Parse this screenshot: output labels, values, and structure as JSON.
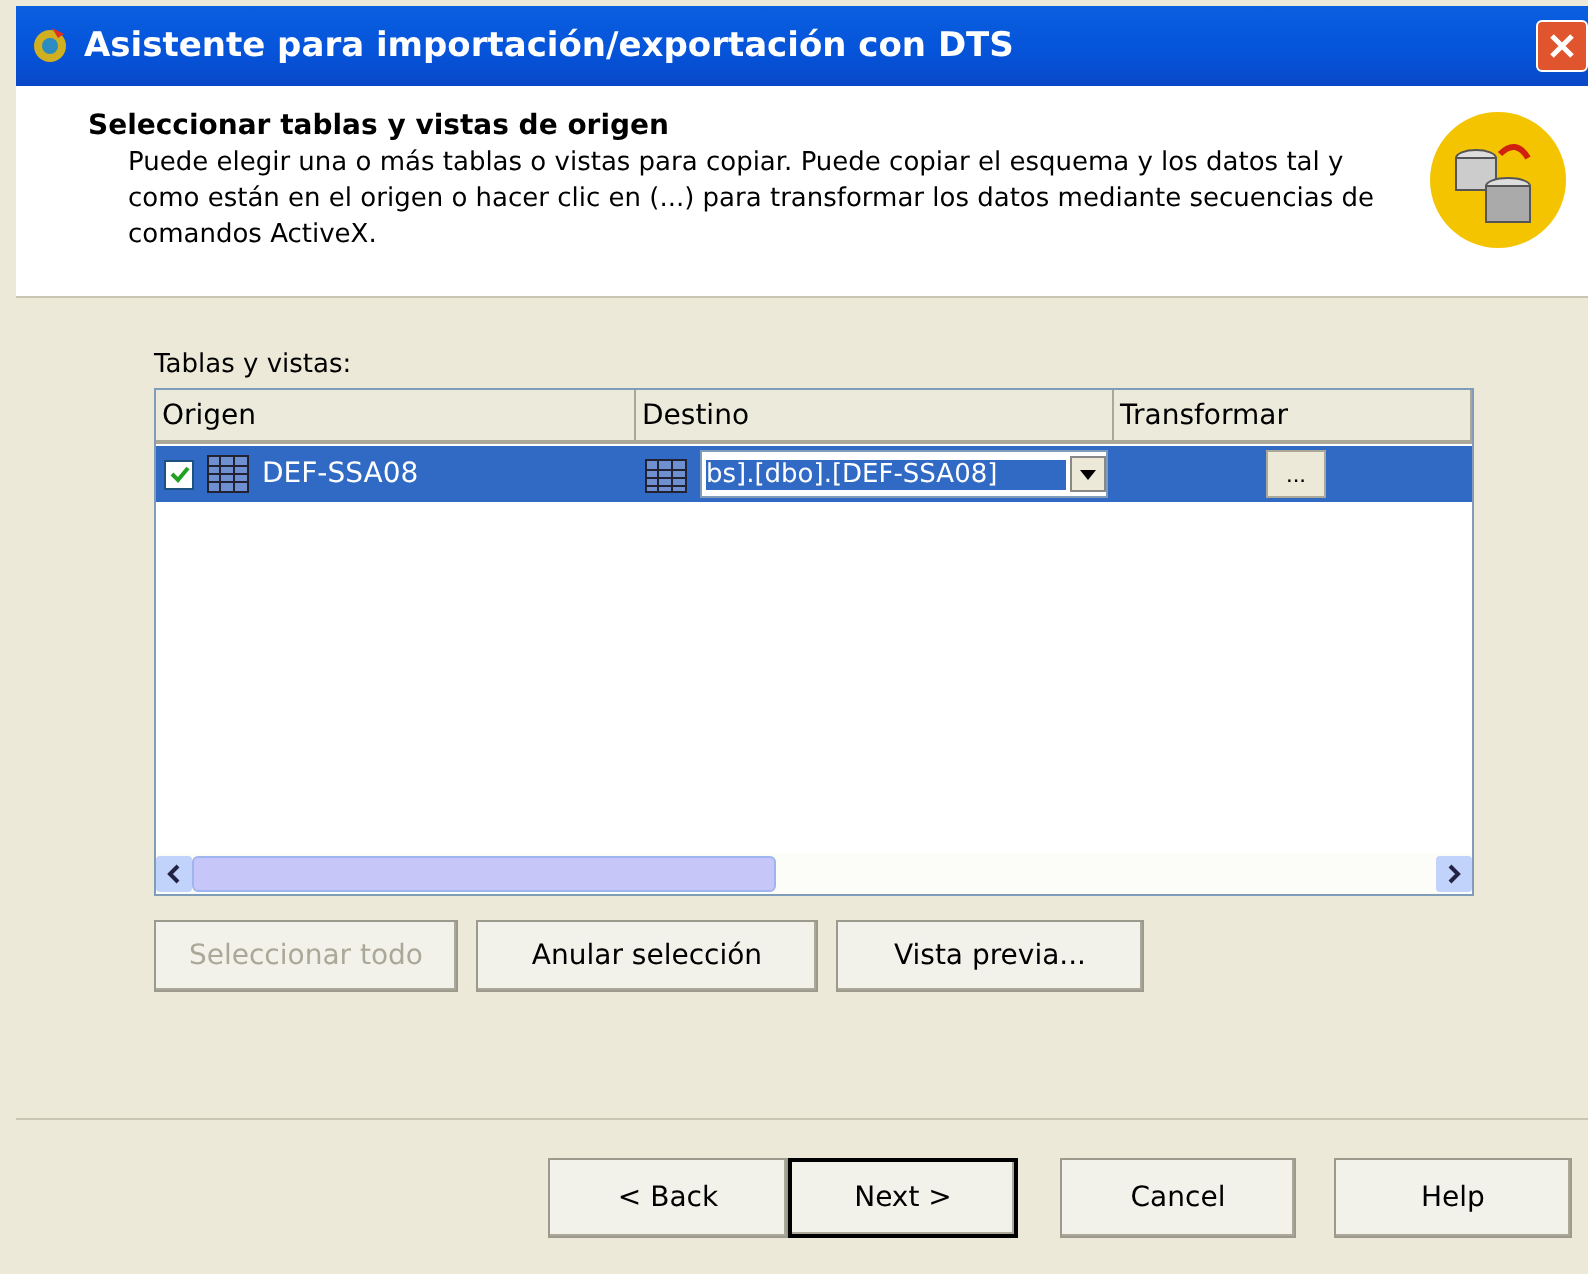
{
  "window": {
    "title": "Asistente para importación/exportación con DTS"
  },
  "header": {
    "title": "Seleccionar tablas y vistas de origen",
    "description": "Puede elegir una o más tablas o vistas para copiar. Puede copiar el esquema y los datos tal y como están en el origen o hacer clic en (...) para transformar los datos mediante secuencias de comandos ActiveX."
  },
  "table": {
    "label": "Tablas y vistas:",
    "columns": [
      "Origen",
      "Destino",
      "Transformar"
    ],
    "rows": [
      {
        "origin": "DEF-SSA08",
        "checked": true,
        "selected": true,
        "destination": "bs].[dbo].[DEF-SSA08]",
        "transform": "..."
      }
    ]
  },
  "actions": [
    {
      "label": "Seleccionar todo",
      "disabled": true
    },
    {
      "label": "Anular selección",
      "disabled": false
    },
    {
      "label": "Vista previa...",
      "disabled": false
    }
  ],
  "nav": [
    {
      "label": "< Back",
      "default": false
    },
    {
      "label": "Next >",
      "default": true
    },
    {
      "label": "Cancel",
      "default": false
    },
    {
      "label": "Help",
      "default": false
    }
  ]
}
